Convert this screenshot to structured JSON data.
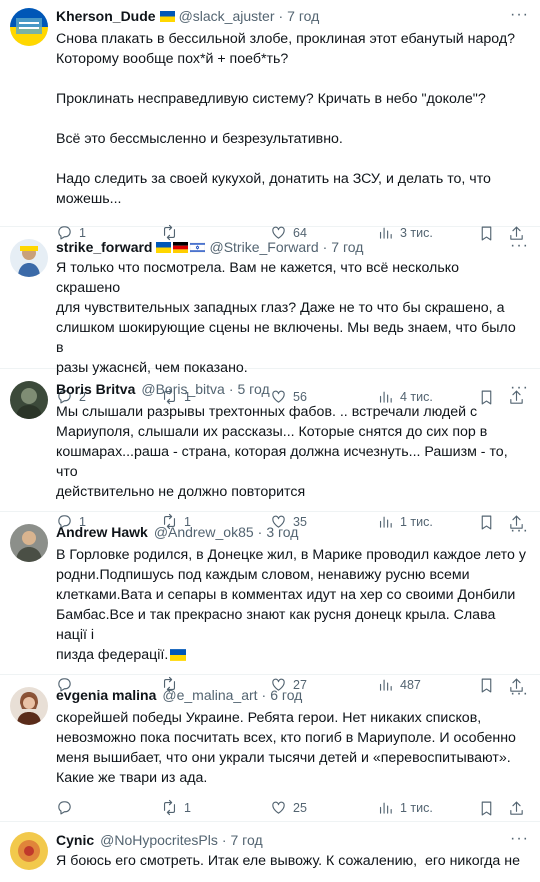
{
  "replies": [
    {
      "name": "Kherson_Dude",
      "flags": [
        "ua"
      ],
      "handle": "@slack_ajuster",
      "time": "7 год",
      "text": "Снова плакать в бессильной злобе, проклиная этот ебанутый народ?\nКоторому вообще пох*й + поеб*ть?\n\nПроклинать несправедливую систему? Кричать в небо \"доколе\"?\n\nВсё это бессмысленно и безрезультативно.\n\nНадо следить за своей кукухой, донатить на ЗСУ, и делать то, что\nможешь...",
      "replies": "1",
      "reposts": "",
      "likes": "64",
      "views": "3 тис.",
      "avatar": "avatar-kherson"
    },
    {
      "name": "strike_forward",
      "flags": [
        "ua",
        "de",
        "il"
      ],
      "handle": "@Strike_Forward",
      "time": "7 год",
      "text": "Я только что посмотрела. Вам не кажется, что всё несколько скрашено\nдля чувствительных западных глаз? Даже не то что бы скрашено, а\nслишком шокирующие сцены не включены. Мы ведь знаем, что было в\nразы ужаснєй, чем показано.",
      "replies": "2",
      "reposts": "1",
      "likes": "56",
      "views": "4 тис.",
      "avatar": "avatar-strike"
    },
    {
      "name": "Boris Britva",
      "flags": [],
      "handle": "@Boris_bitva",
      "time": "5 год",
      "text": "Мы слышали разрывы трехтонных фабов. .. встречали людей с\nМариуполя, слышали их рассказы... Которые снятся до сих пор в\nкошмарах...раша - страна, которая должна исчезнуть... Рашизм - то, что\nдействительно не должно повторится",
      "replies": "1",
      "reposts": "1",
      "likes": "35",
      "views": "1 тис.",
      "avatar": "avatar-boris"
    },
    {
      "name": "Andrew Hawk",
      "flags": [],
      "handle": "@Andrew_ok85",
      "time": "3 год",
      "text": "В Горловке родился, в Донецке жил, в Марике проводил каждое лето у\nродни.Подпишусь под каждым словом, ненавижу русню всеми\nклетками.Вата и сепары в комментах идут на хер со своими Донбили\nБамбас.Все и так прекрасно знают как русня донецк крыла. Слава нації і\nпизда федерації.",
      "text_flag": true,
      "replies": "",
      "reposts": "",
      "likes": "27",
      "views": "487",
      "avatar": "avatar-andrew"
    },
    {
      "name": "evgenia malina",
      "flags": [],
      "handle": "@e_malina_art",
      "time": "6 год",
      "text": "скорейшей победы Украине. Ребята герои. Нет никаких списков,\nневозможно пока посчитать всех, кто погиб в Мариуполе. И особенно\nменя вышибает, что они украли тысячи детей и «перевоспитывают».\nКакие же твари из ада.",
      "replies": "",
      "reposts": "1",
      "likes": "25",
      "views": "1 тис.",
      "avatar": "avatar-evgenia"
    },
    {
      "name": "Cynic",
      "flags": [],
      "handle": "@NoHypocritesPls",
      "time": "7 год",
      "text": "Я боюсь его смотреть. Итак еле вывожу. К сожалению,  его никогда не",
      "replies": "",
      "reposts": "",
      "likes": "",
      "views": "",
      "avatar": "avatar-cynic"
    }
  ],
  "icons": [
    "reply-icon",
    "repost-icon",
    "like-icon",
    "views-icon",
    "bookmark-icon",
    "share-icon",
    "more-icon"
  ],
  "colors": {
    "text": "#0f1419",
    "secondary": "#536471",
    "divider": "#eff3f4",
    "flag_blue": "#0057b7",
    "flag_yellow": "#ffd700"
  }
}
